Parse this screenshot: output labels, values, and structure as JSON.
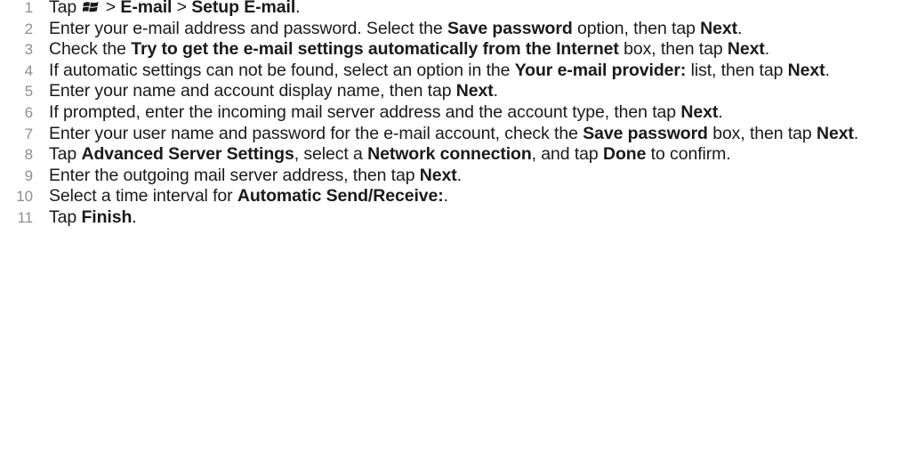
{
  "steps": [
    {
      "number": "1",
      "parts": [
        {
          "t": "Tap "
        },
        {
          "icon": "windows-start-icon"
        },
        {
          "t": " > "
        },
        {
          "b": "E-mail"
        },
        {
          "t": " > "
        },
        {
          "b": "Setup E-mail"
        },
        {
          "t": "."
        }
      ]
    },
    {
      "number": "2",
      "parts": [
        {
          "t": "Enter your e-mail address and password. Select the "
        },
        {
          "b": "Save password"
        },
        {
          "t": " option, then tap "
        },
        {
          "b": "Next"
        },
        {
          "t": "."
        }
      ]
    },
    {
      "number": "3",
      "parts": [
        {
          "t": "Check the "
        },
        {
          "b": "Try to get the e-mail settings automatically from the Internet"
        },
        {
          "t": " box, then tap "
        },
        {
          "b": "Next"
        },
        {
          "t": "."
        }
      ]
    },
    {
      "number": "4",
      "parts": [
        {
          "t": "If automatic settings can not be found, select an option in the "
        },
        {
          "b": "Your e-mail provider:"
        },
        {
          "t": " list, then tap "
        },
        {
          "b": "Next"
        },
        {
          "t": "."
        }
      ]
    },
    {
      "number": "5",
      "parts": [
        {
          "t": "Enter your name and account display name, then tap "
        },
        {
          "b": "Next"
        },
        {
          "t": "."
        }
      ]
    },
    {
      "number": "6",
      "parts": [
        {
          "t": "If prompted, enter the incoming mail server address and the account type, then tap "
        },
        {
          "b": "Next"
        },
        {
          "t": "."
        }
      ]
    },
    {
      "number": "7",
      "parts": [
        {
          "t": "Enter your user name and password for the e-mail account, check the "
        },
        {
          "b": "Save password"
        },
        {
          "t": " box, then tap "
        },
        {
          "b": "Next"
        },
        {
          "t": "."
        }
      ]
    },
    {
      "number": "8",
      "parts": [
        {
          "t": "Tap "
        },
        {
          "b": "Advanced Server Settings"
        },
        {
          "t": ", select a "
        },
        {
          "b": "Network connection"
        },
        {
          "t": ", and tap "
        },
        {
          "b": "Done"
        },
        {
          "t": " to confirm."
        }
      ]
    },
    {
      "number": "9",
      "parts": [
        {
          "t": "Enter the outgoing mail server address, then tap "
        },
        {
          "b": "Next"
        },
        {
          "t": "."
        }
      ]
    },
    {
      "number": "10",
      "parts": [
        {
          "t": "Select a time interval for "
        },
        {
          "b": "Automatic Send/Receive:"
        },
        {
          "t": "."
        }
      ]
    },
    {
      "number": "11",
      "parts": [
        {
          "t": "Tap "
        },
        {
          "b": "Finish"
        },
        {
          "t": "."
        }
      ]
    }
  ]
}
